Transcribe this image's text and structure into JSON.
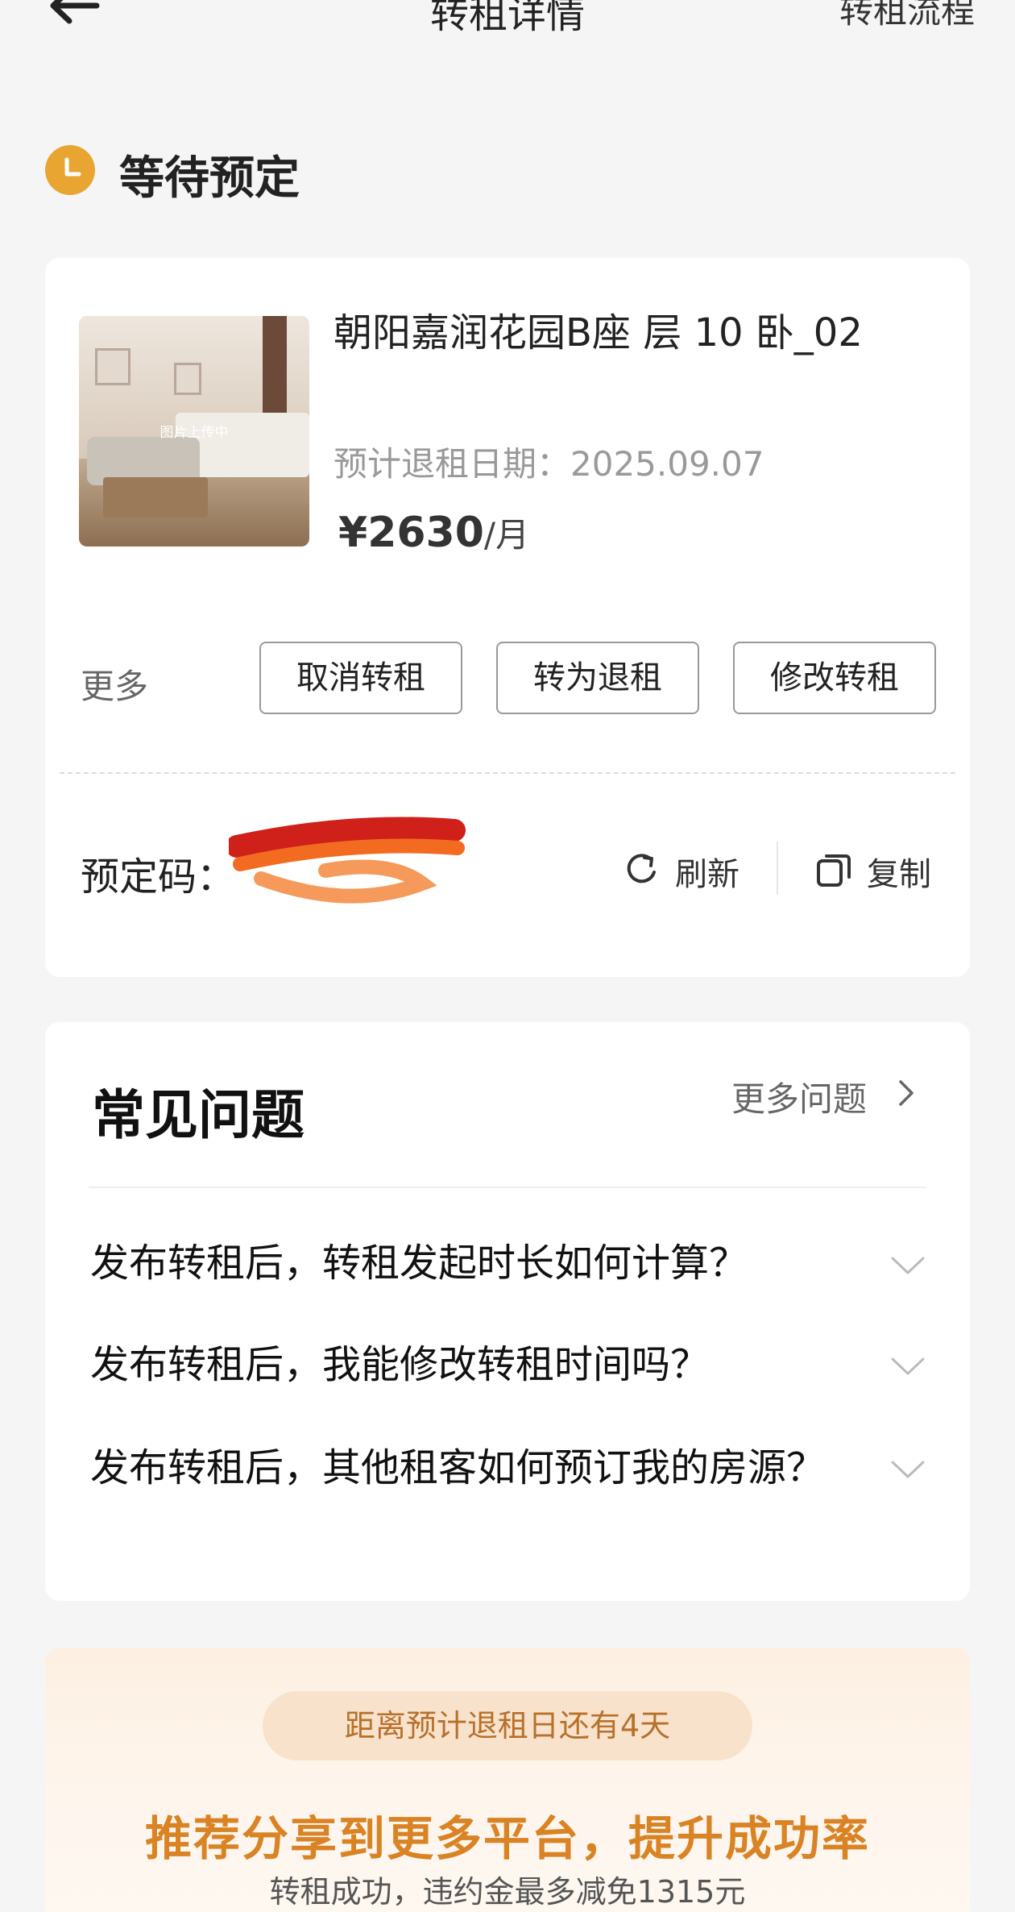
{
  "nav": {
    "title": "转租详情",
    "right_link": "转租流程"
  },
  "status": {
    "text": "等待预定",
    "icon": "clock-icon",
    "icon_color": "#e8a531"
  },
  "listing": {
    "thumbnail_overlay": "图片上传中",
    "title": "朝阳嘉润花园B座 层 10 卧_02",
    "retire_date": "预计退租日期：2025.09.07",
    "price_symbol": "¥",
    "price_value": "2630",
    "price_unit": "/月"
  },
  "actions": {
    "more_label": "更多",
    "cancel": "取消转租",
    "to_retire": "转为退租",
    "edit": "修改转租"
  },
  "booking": {
    "code_label": "预定码：",
    "refresh": "刷新",
    "copy": "复制"
  },
  "faq": {
    "title": "常见问题",
    "more": "更多问题",
    "items": [
      {
        "question": "发布转租后，转租发起时长如何计算？"
      },
      {
        "question": "发布转租后，我能修改转租时间吗？"
      },
      {
        "question": "发布转租后，其他租客如何预订我的房源？"
      }
    ]
  },
  "promo": {
    "countdown": "距离预计退租日还有4天",
    "headline": "推荐分享到更多平台，提升成功率",
    "sub": "转租成功，违约金最多减免1315元",
    "accent_color": "#d98324"
  }
}
